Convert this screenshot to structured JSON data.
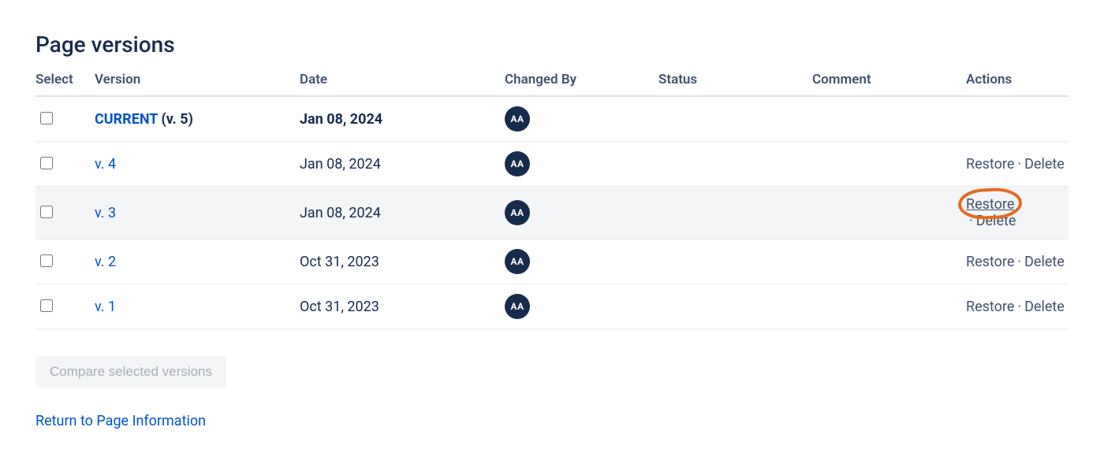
{
  "title": "Page versions",
  "columns": {
    "select": "Select",
    "version": "Version",
    "date": "Date",
    "changedBy": "Changed By",
    "status": "Status",
    "comment": "Comment",
    "actions": "Actions"
  },
  "avatarInitials": "AA",
  "actionLabels": {
    "restore": "Restore",
    "delete": "Delete",
    "separator": "·"
  },
  "rows": [
    {
      "isCurrent": true,
      "currentLabel": "CURRENT",
      "versionSuffix": " (v. 5)",
      "date": "Jan 08, 2024",
      "highlighted": false,
      "hasActions": false,
      "restoreEmphasis": false
    },
    {
      "isCurrent": false,
      "versionLabel": "v. 4",
      "date": "Jan 08, 2024",
      "highlighted": false,
      "hasActions": true,
      "restoreEmphasis": false
    },
    {
      "isCurrent": false,
      "versionLabel": "v. 3",
      "date": "Jan 08, 2024",
      "highlighted": true,
      "hasActions": true,
      "restoreEmphasis": true
    },
    {
      "isCurrent": false,
      "versionLabel": "v. 2",
      "date": "Oct 31, 2023",
      "highlighted": false,
      "hasActions": true,
      "restoreEmphasis": false
    },
    {
      "isCurrent": false,
      "versionLabel": "v. 1",
      "date": "Oct 31, 2023",
      "highlighted": false,
      "hasActions": true,
      "restoreEmphasis": false
    }
  ],
  "compareButton": "Compare selected versions",
  "returnLink": "Return to Page Information"
}
